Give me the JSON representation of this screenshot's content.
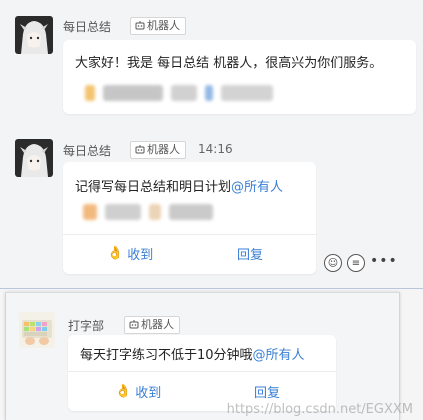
{
  "messages": [
    {
      "sender": "每日总结",
      "tag": "机器人",
      "time": "",
      "text": "大家好！我是 每日总结 机器人，很高兴为你们服务。",
      "mention": "",
      "actions": []
    },
    {
      "sender": "每日总结",
      "tag": "机器人",
      "time": "14:16",
      "text": "记得写每日总结和明日计划",
      "mention": "@所有人",
      "actions": [
        {
          "icon": "hand-icon",
          "label": "收到"
        },
        {
          "icon": "",
          "label": "回复"
        }
      ]
    },
    {
      "sender": "打字部",
      "tag": "机器人",
      "time": "",
      "text": "每天打字练习不低于10分钟哦",
      "mention": "@所有人",
      "actions": [
        {
          "icon": "hand-icon",
          "label": "收到"
        },
        {
          "icon": "",
          "label": "回复"
        }
      ]
    }
  ],
  "toolbar_icons": [
    "emoji-icon",
    "comment-icon",
    "more-icon"
  ],
  "watermark": "https://blog.csdn.net/EGXXM",
  "colors": {
    "link": "#3a7fd5",
    "bubble": "#ffffff",
    "background": "#f3f4f6"
  }
}
